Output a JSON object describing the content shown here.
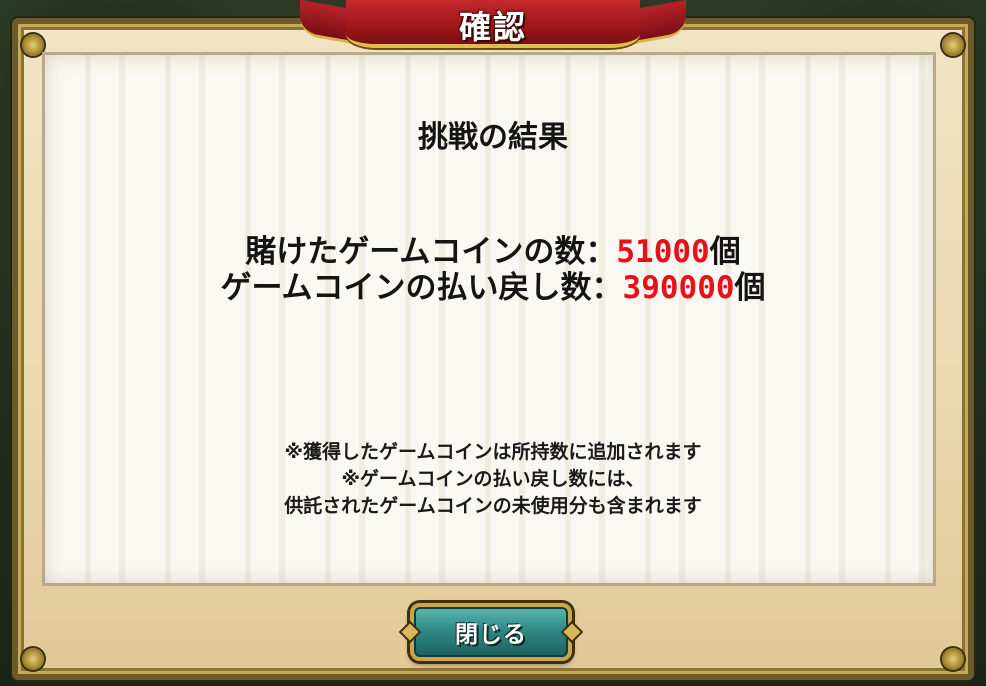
{
  "dialog": {
    "title": "確認",
    "heading": "挑戦の結果",
    "bet": {
      "label": "賭けたゲームコインの数：",
      "value": "51000",
      "unit": "個"
    },
    "payout": {
      "label": "ゲームコインの払い戻し数：",
      "value": "390000",
      "unit": "個"
    },
    "notes": [
      "※獲得したゲームコインは所持数に追加されます",
      "※ゲームコインの払い戻し数には、",
      "供託されたゲームコインの未使用分も含まれます"
    ],
    "close_button_label": "閉じる"
  },
  "colors": {
    "value_highlight": "#e8101a",
    "ribbon": "#b8222a",
    "button": "#2f8a86",
    "frame_gold": "#c8a95a"
  }
}
